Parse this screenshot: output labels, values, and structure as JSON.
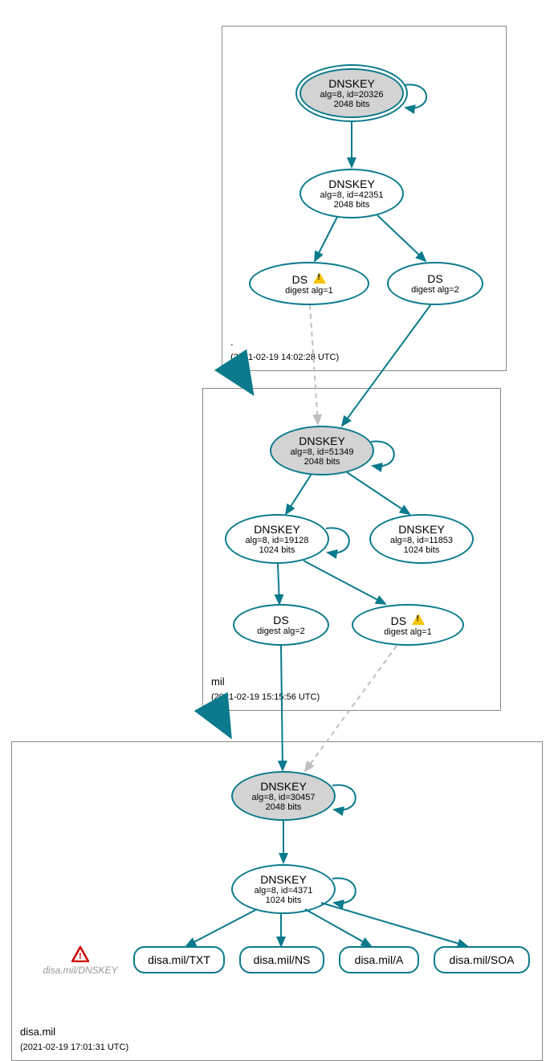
{
  "zones": {
    "root": {
      "label": ".",
      "ts": "(2021-02-19 14:02:28 UTC)"
    },
    "mil": {
      "label": "mil",
      "ts": "(2021-02-19 15:15:56 UTC)"
    },
    "disa": {
      "label": "disa.mil",
      "ts": "(2021-02-19 17:01:31 UTC)"
    }
  },
  "nodes": {
    "root_ksk": {
      "title": "DNSKEY",
      "sub1": "alg=8, id=20326",
      "sub2": "2048 bits"
    },
    "root_zsk": {
      "title": "DNSKEY",
      "sub1": "alg=8, id=42351",
      "sub2": "2048 bits"
    },
    "root_ds1": {
      "title": "DS",
      "sub1": "digest alg=1",
      "warn": true
    },
    "root_ds2": {
      "title": "DS",
      "sub1": "digest alg=2"
    },
    "mil_ksk": {
      "title": "DNSKEY",
      "sub1": "alg=8, id=51349",
      "sub2": "2048 bits"
    },
    "mil_zsk1": {
      "title": "DNSKEY",
      "sub1": "alg=8, id=19128",
      "sub2": "1024 bits"
    },
    "mil_zsk2": {
      "title": "DNSKEY",
      "sub1": "alg=8, id=11853",
      "sub2": "1024 bits"
    },
    "mil_ds2": {
      "title": "DS",
      "sub1": "digest alg=2"
    },
    "mil_ds1": {
      "title": "DS",
      "sub1": "digest alg=1",
      "warn": true
    },
    "disa_ksk": {
      "title": "DNSKEY",
      "sub1": "alg=8, id=30457",
      "sub2": "2048 bits"
    },
    "disa_zsk": {
      "title": "DNSKEY",
      "sub1": "alg=8, id=4371",
      "sub2": "1024 bits"
    },
    "disa_txt": {
      "label": "disa.mil/TXT"
    },
    "disa_ns": {
      "label": "disa.mil/NS"
    },
    "disa_a": {
      "label": "disa.mil/A"
    },
    "disa_soa": {
      "label": "disa.mil/SOA"
    },
    "disa_dnskey_err": {
      "label": "disa.mil/DNSKEY"
    }
  },
  "colors": {
    "edge": "#0a7a8c",
    "edgeLight": "#bfbfbf"
  }
}
